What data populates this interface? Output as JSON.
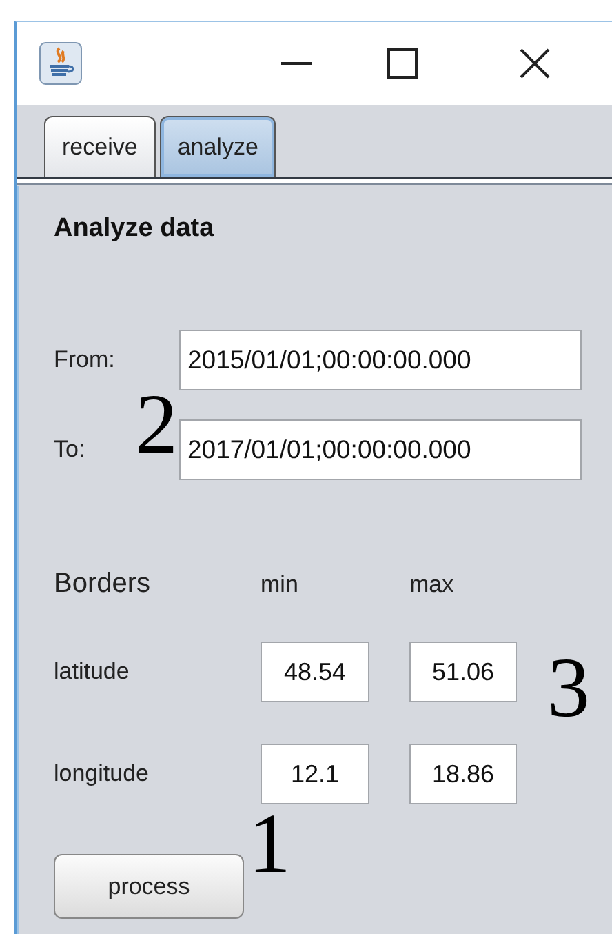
{
  "tabs": [
    {
      "label": "receive",
      "selected": false
    },
    {
      "label": "analyze",
      "selected": true
    }
  ],
  "panel": {
    "title": "Analyze data",
    "date_range": [
      {
        "label": "From:",
        "value": "2015/01/01;00:00:00.000"
      },
      {
        "label": "To:",
        "value": "2017/01/01;00:00:00.000"
      }
    ],
    "borders": {
      "title": "Borders",
      "columns": [
        "min",
        "max"
      ],
      "rows": [
        {
          "label": "latitude",
          "min": "48.54",
          "max": "51.06"
        },
        {
          "label": "longitude",
          "min": "12.1",
          "max": "18.86"
        }
      ]
    },
    "button": "process"
  },
  "annotations": [
    "2",
    "3",
    "1"
  ]
}
